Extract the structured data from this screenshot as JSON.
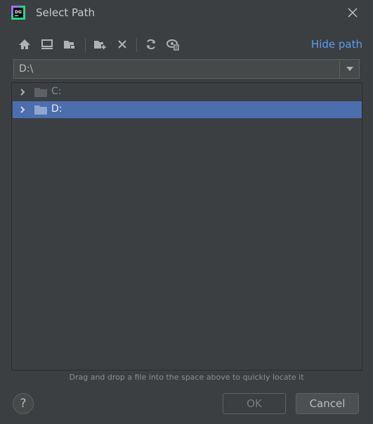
{
  "window": {
    "title": "Select Path",
    "logo_text": "DG"
  },
  "toolbar": {
    "icons": [
      "home-icon",
      "desktop-icon",
      "project-folder-icon",
      "new-folder-icon",
      "delete-icon",
      "refresh-icon",
      "show-hidden-icon"
    ],
    "hide_path_label": "Hide path"
  },
  "path": {
    "value": "D:\\"
  },
  "tree": {
    "items": [
      {
        "label": "C:",
        "selected": false
      },
      {
        "label": "D:",
        "selected": true
      }
    ]
  },
  "hint": "Drag and drop a file into the space above to quickly locate it",
  "buttons": {
    "help": "?",
    "ok": "OK",
    "cancel": "Cancel"
  },
  "colors": {
    "background": "#3c3f41",
    "selection": "#4b6eaf",
    "link": "#589df6"
  }
}
